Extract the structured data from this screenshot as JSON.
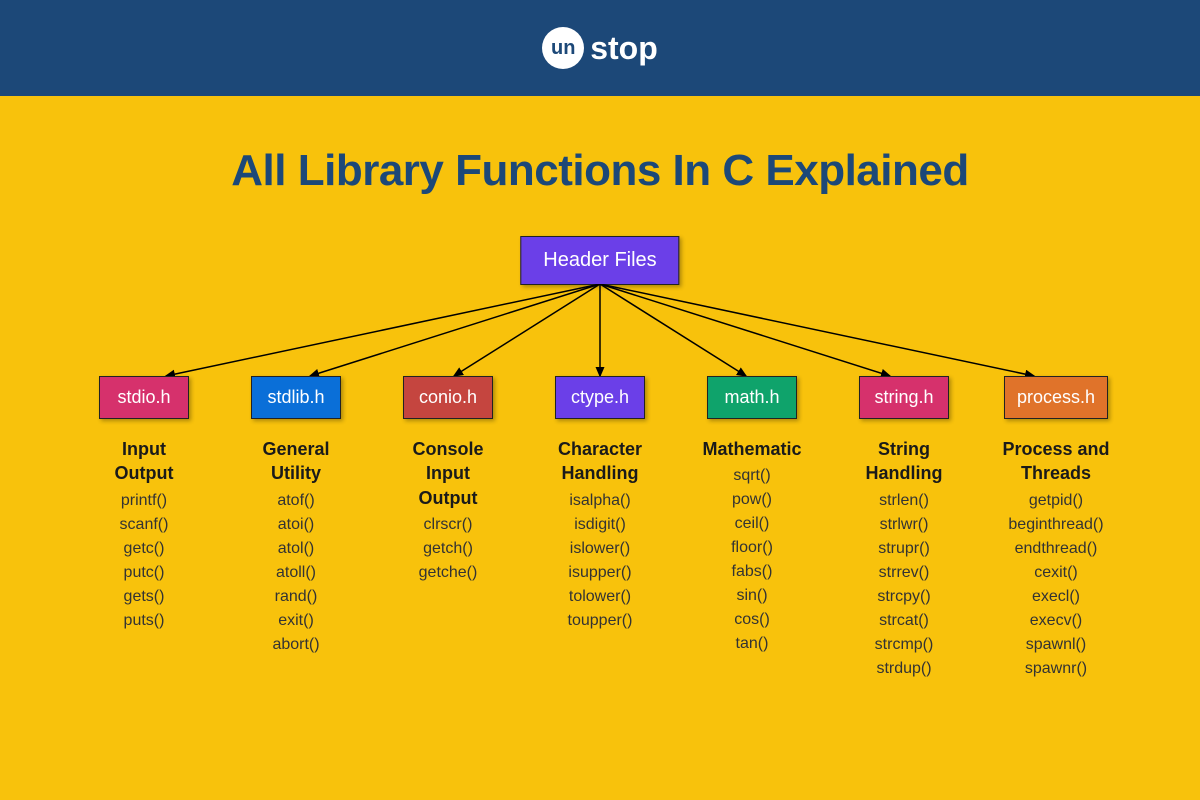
{
  "brand": {
    "circle": "un",
    "rest": "stop"
  },
  "title": "All Library Functions In C Explained",
  "root": "Header Files",
  "columns": [
    {
      "header": "stdio.h",
      "color": "#d6316c",
      "category": "Input\nOutput",
      "funcs": [
        "printf()",
        "scanf()",
        "getc()",
        "putc()",
        "gets()",
        "puts()"
      ]
    },
    {
      "header": "stdlib.h",
      "color": "#0a6fd8",
      "category": "General\nUtility",
      "funcs": [
        "atof()",
        "atoi()",
        "atol()",
        "atoll()",
        "rand()",
        "exit()",
        "abort()"
      ]
    },
    {
      "header": "conio.h",
      "color": "#c5453f",
      "category": "Console\nInput\nOutput",
      "funcs": [
        "clrscr()",
        "getch()",
        "getche()"
      ]
    },
    {
      "header": "ctype.h",
      "color": "#6b3fe8",
      "category": "Character\nHandling",
      "funcs": [
        "isalpha()",
        "isdigit()",
        "islower()",
        "isupper()",
        "tolower()",
        "toupper()"
      ]
    },
    {
      "header": "math.h",
      "color": "#0fa36b",
      "category": "Mathematic",
      "funcs": [
        "sqrt()",
        "pow()",
        "ceil()",
        "floor()",
        "fabs()",
        "sin()",
        "cos()",
        "tan()"
      ]
    },
    {
      "header": "string.h",
      "color": "#d6316c",
      "category": "String\nHandling",
      "funcs": [
        "strlen()",
        "strlwr()",
        "strupr()",
        "strrev()",
        "strcpy()",
        "strcat()",
        "strcmp()",
        "strdup()"
      ]
    },
    {
      "header": "process.h",
      "color": "#e0732a",
      "category": "Process and\nThreads",
      "funcs": [
        "getpid()",
        "beginthread()",
        "endthread()",
        "cexit()",
        "execl()",
        "execv()",
        "spawnl()",
        "spawnr()"
      ]
    }
  ]
}
